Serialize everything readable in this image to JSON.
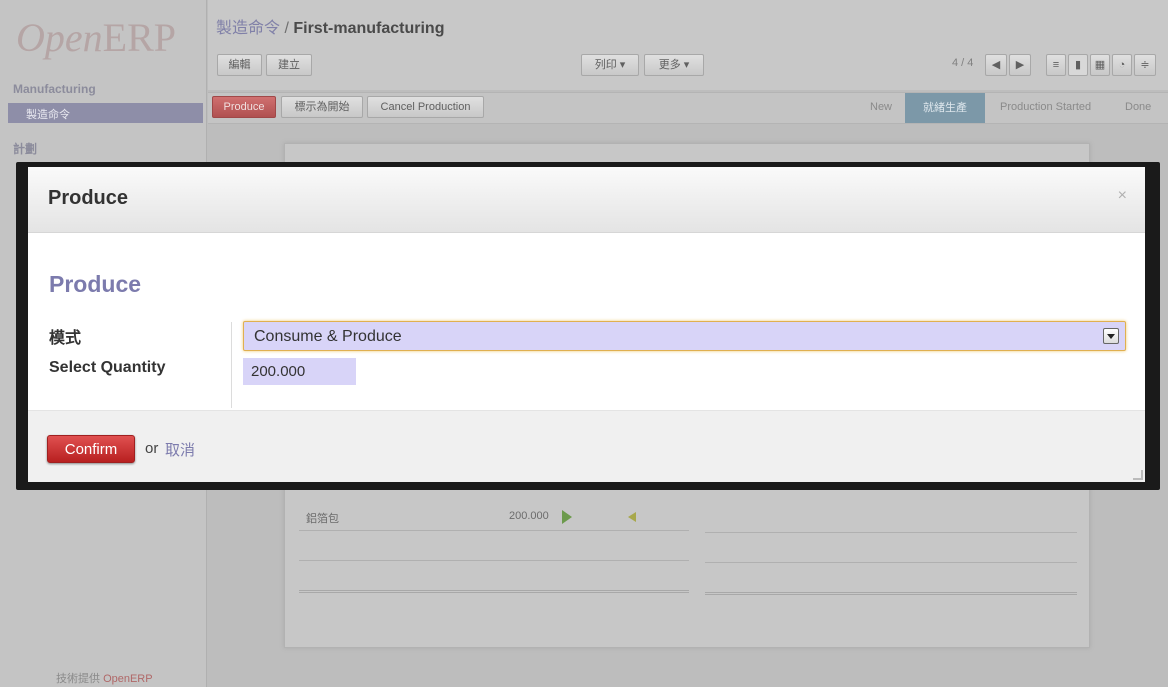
{
  "app": {
    "logo_text": "Open",
    "logo_erp": "ERP",
    "powered_prefix": "技術提供",
    "powered_brand": "OpenERP"
  },
  "sidebar": {
    "section": "Manufacturing",
    "active_item": "製造命令",
    "section2": "計劃"
  },
  "breadcrumb": {
    "parent": "製造命令",
    "separator": " / ",
    "current": "First-manufacturing"
  },
  "toolbar": {
    "edit_label": "編輯",
    "create_label": "建立",
    "print_label": "列印 ▾",
    "more_label": "更多 ▾",
    "pager": "4 / 4"
  },
  "statusbar": {
    "produce_label": "Produce",
    "mark_start_label": "標示為開始",
    "cancel_production_label": "Cancel Production",
    "stages": [
      "New",
      "就緒生產",
      "Production Started",
      "Done"
    ],
    "active_stage_index": 1
  },
  "sheet": {
    "product": "鋁箔包",
    "quantity": "200.000"
  },
  "modal": {
    "title": "Produce",
    "close_glyph": "×",
    "form_heading": "Produce",
    "mode_label": "模式",
    "mode_value": "Consume & Produce",
    "quantity_label": "Select Quantity",
    "quantity_value": "200.000",
    "confirm_label": "Confirm",
    "or_text": "or",
    "cancel_label": "取消"
  },
  "colors": {
    "accent_purple": "#7c7bad",
    "confirm_red": "#c83030",
    "input_bg": "#d8d4f8"
  }
}
